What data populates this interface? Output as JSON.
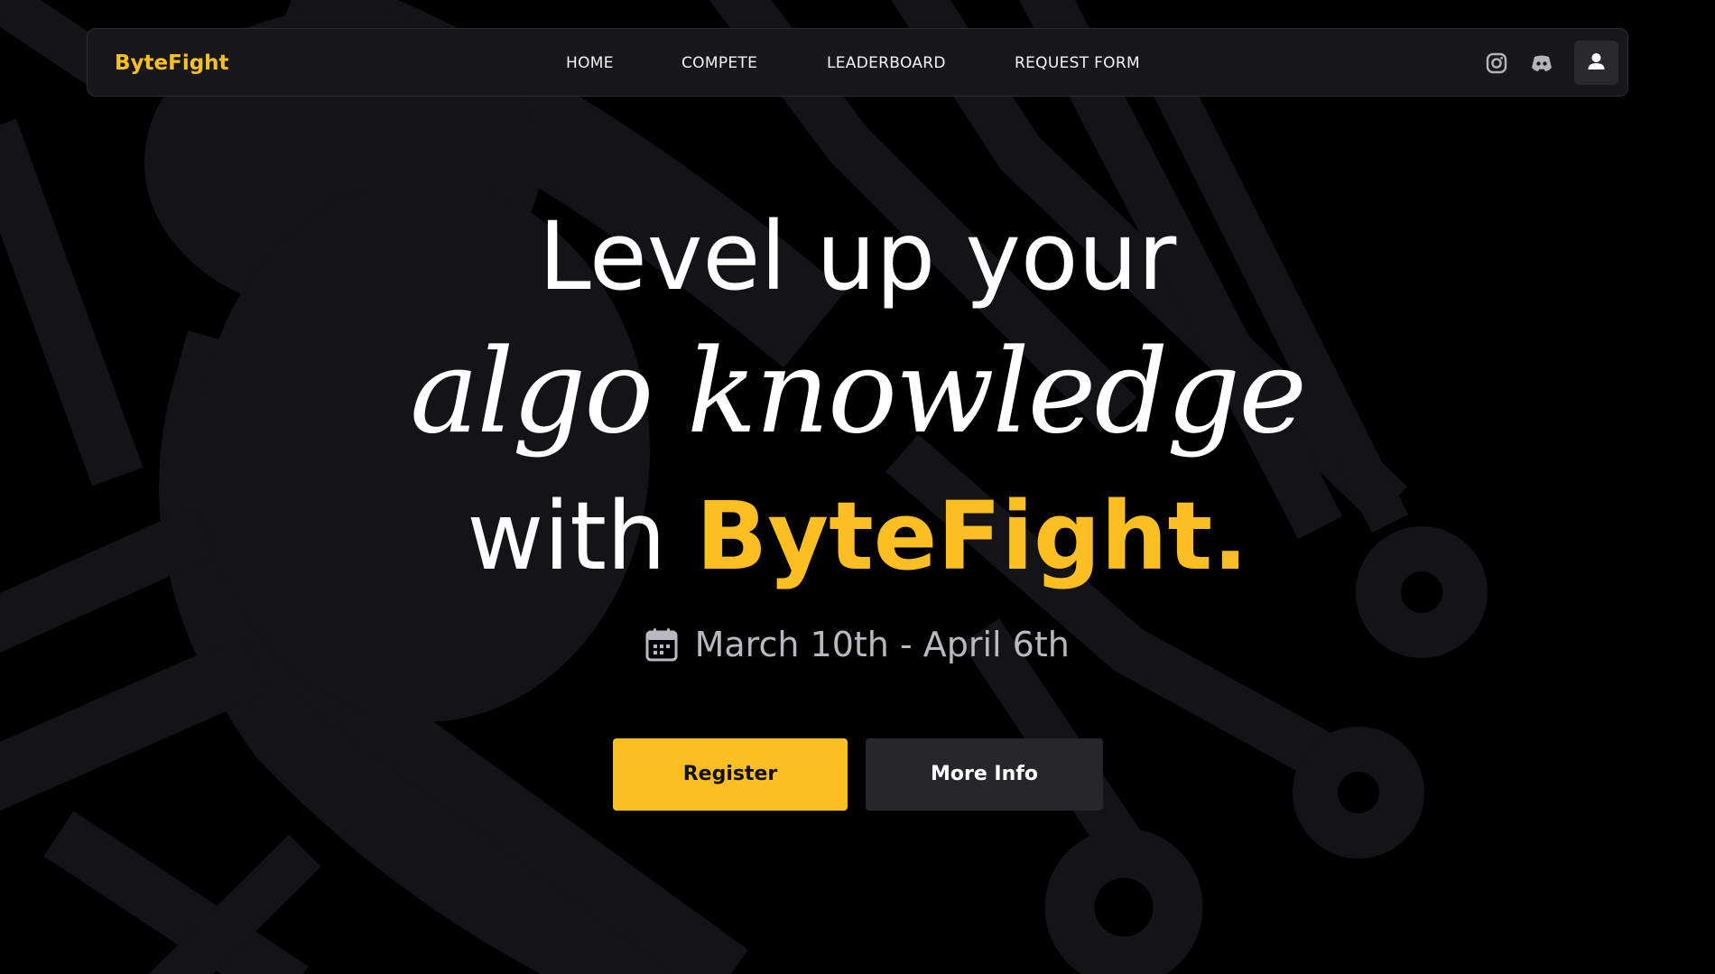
{
  "nav": {
    "brand": "ByteFight",
    "links": [
      {
        "label": "HOME"
      },
      {
        "label": "COMPETE"
      },
      {
        "label": "LEADERBOARD"
      },
      {
        "label": "REQUEST FORM"
      }
    ],
    "icons": [
      "instagram-icon",
      "discord-icon",
      "user-icon"
    ]
  },
  "hero": {
    "line1": "Level up your",
    "line2": "algo knowledge",
    "line3_prefix": "with",
    "line3_brand": "ByteFight."
  },
  "event": {
    "icon": "calendar-icon",
    "dates": "March 10th - April 6th"
  },
  "actions": {
    "register_label": "Register",
    "more_info_label": "More Info"
  },
  "colors": {
    "accent": "#fbbf24",
    "background": "#000000",
    "nav_bg": "#18181b",
    "pattern": "#141416",
    "secondary_button": "#27272a"
  }
}
